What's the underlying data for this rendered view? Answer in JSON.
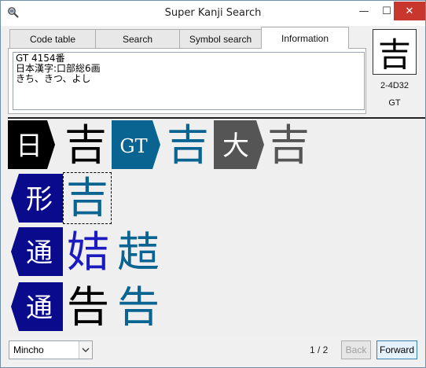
{
  "window": {
    "title": "Super Kanji Search",
    "controls": {
      "minimize": "—",
      "maximize": "☐",
      "close": "✕"
    }
  },
  "tabs": [
    {
      "label": "Code table",
      "active": false
    },
    {
      "label": "Search",
      "active": false
    },
    {
      "label": "Symbol search",
      "active": false
    },
    {
      "label": "Information",
      "active": true
    }
  ],
  "info": {
    "line1": "GT 4154番",
    "line2": "日本漢字:口部総6画",
    "line3": "きち、きつ、よし"
  },
  "preview": {
    "kanji": "吉",
    "code": "2-4D32",
    "font_set": "GT"
  },
  "results": [
    {
      "tag": "日",
      "tag_color": "#000000",
      "glyphs": [
        {
          "char": "吉",
          "color": "#000000"
        }
      ]
    },
    {
      "tag": "GT",
      "tag_color": "#0a6492",
      "glyphs": [
        {
          "char": "吉",
          "color": "#0a6492"
        }
      ]
    },
    {
      "tag": "大",
      "tag_color": "#555555",
      "glyphs": [
        {
          "char": "吉",
          "color": "#555555"
        }
      ]
    },
    {
      "tag": "形",
      "tag_color": "#0a0a8c",
      "glyphs": [
        {
          "char": "吉",
          "color": "#0a6492",
          "selected": true
        }
      ]
    },
    {
      "tag": "通",
      "tag_color": "#0a0a8c",
      "glyphs": [
        {
          "char": "姞",
          "color": "#1a1abf"
        },
        {
          "char": "趌",
          "color": "#0a6492"
        }
      ]
    },
    {
      "tag": "通",
      "tag_color": "#0a0a8c",
      "glyphs": [
        {
          "char": "告",
          "color": "#000000"
        },
        {
          "char": "告",
          "color": "#0a6492"
        }
      ]
    }
  ],
  "footer": {
    "font_select": "Mincho",
    "page": "1 / 2",
    "back_label": "Back",
    "forward_label": "Forward"
  }
}
